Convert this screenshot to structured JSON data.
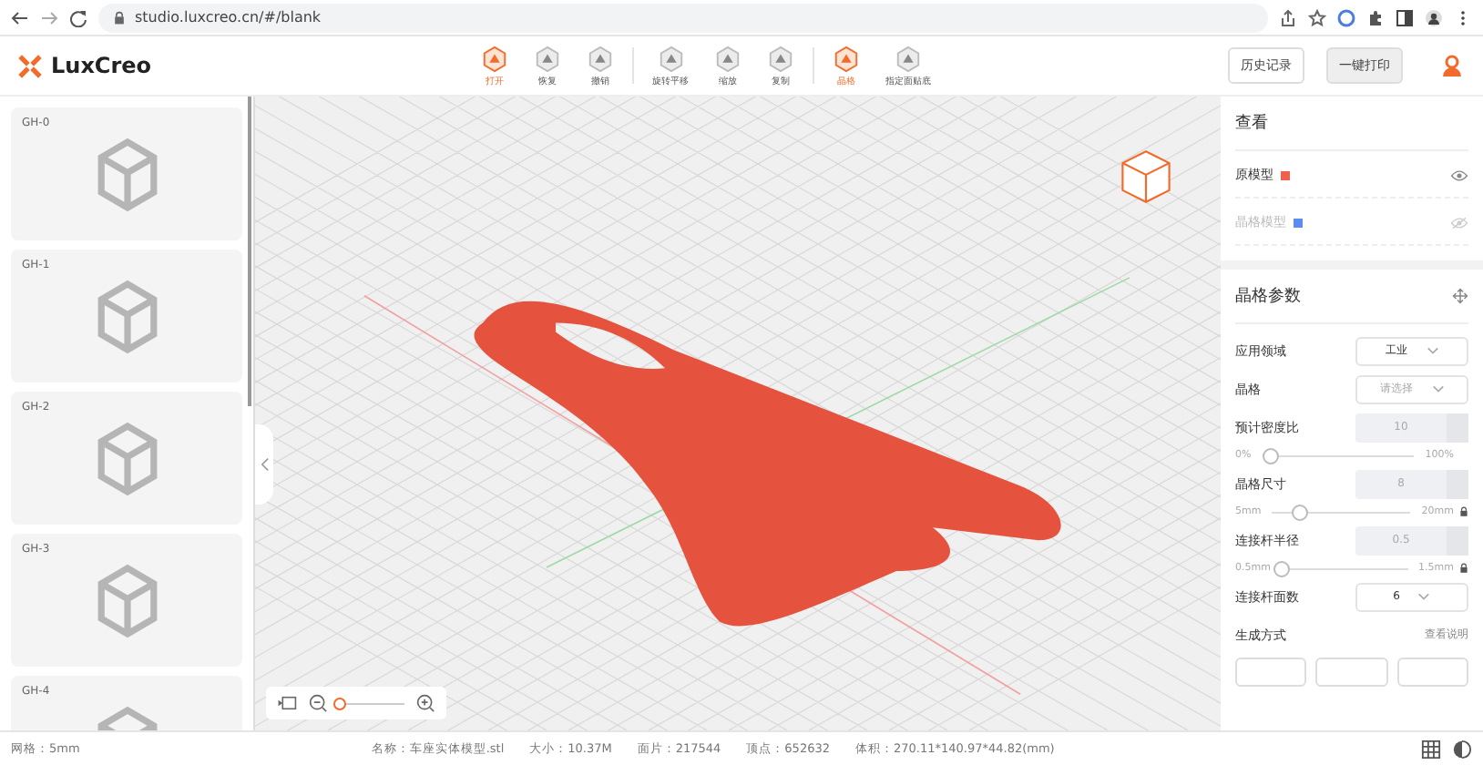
{
  "browser": {
    "url": "studio.luxcreo.cn/#/blank"
  },
  "app": {
    "logo": "LuxCreo",
    "history_button": "历史记录",
    "print_button": "一键打印"
  },
  "toolbar": [
    {
      "label": "打开",
      "highlighted": true,
      "separator_before": false
    },
    {
      "label": "恢复",
      "highlighted": false,
      "separator_before": false
    },
    {
      "label": "撤销",
      "highlighted": false,
      "separator_before": false
    },
    {
      "label": "旋转平移",
      "highlighted": false,
      "separator_before": true
    },
    {
      "label": "缩放",
      "highlighted": false,
      "separator_before": false
    },
    {
      "label": "复制",
      "highlighted": false,
      "separator_before": false
    },
    {
      "label": "晶格",
      "highlighted": true,
      "separator_before": true
    },
    {
      "label": "指定面贴底",
      "highlighted": false,
      "separator_before": false
    }
  ],
  "sidebar": {
    "items": [
      {
        "label": "GH-0"
      },
      {
        "label": "GH-1"
      },
      {
        "label": "GH-2"
      },
      {
        "label": "GH-3"
      },
      {
        "label": "GH-4"
      }
    ]
  },
  "view_panel": {
    "title": "查看",
    "layers": [
      {
        "name": "原模型",
        "color": "#f0604a",
        "visible": true
      },
      {
        "name": "晶格模型",
        "color": "#5b8def",
        "visible": false
      }
    ]
  },
  "lattice_panel": {
    "title": "晶格参数",
    "fields": [
      {
        "kind": "select",
        "label": "应用领域",
        "value": "工业"
      },
      {
        "kind": "select",
        "label": "晶格",
        "placeholder": "请选择"
      },
      {
        "kind": "slider",
        "label": "预计密度比",
        "value": "10",
        "disabled": true,
        "min": "0%",
        "max": "100%",
        "locked": false,
        "level": 0.05
      },
      {
        "kind": "slider",
        "label": "晶格尺寸",
        "value": "8",
        "disabled": true,
        "min": "5mm",
        "max": "20mm",
        "locked": true,
        "level": 0.2
      },
      {
        "kind": "slider",
        "label": "连接杆半径",
        "value": "0.5",
        "disabled": true,
        "min": "0.5mm",
        "max": "1.5mm",
        "locked": true,
        "level": 0.0
      },
      {
        "kind": "select",
        "label": "连接杆面数",
        "value": "6"
      },
      {
        "kind": "heading",
        "label": "生成方式",
        "link": "查看说明"
      }
    ]
  },
  "zoom": {
    "level": 0.0
  },
  "status_bar": {
    "grid": "网格：5mm",
    "items": [
      "名称：车座实体模型.stl",
      "大小：10.37M",
      "面片：217544",
      "顶点：652632",
      "体积：270.11*140.97*44.82(mm)"
    ]
  }
}
